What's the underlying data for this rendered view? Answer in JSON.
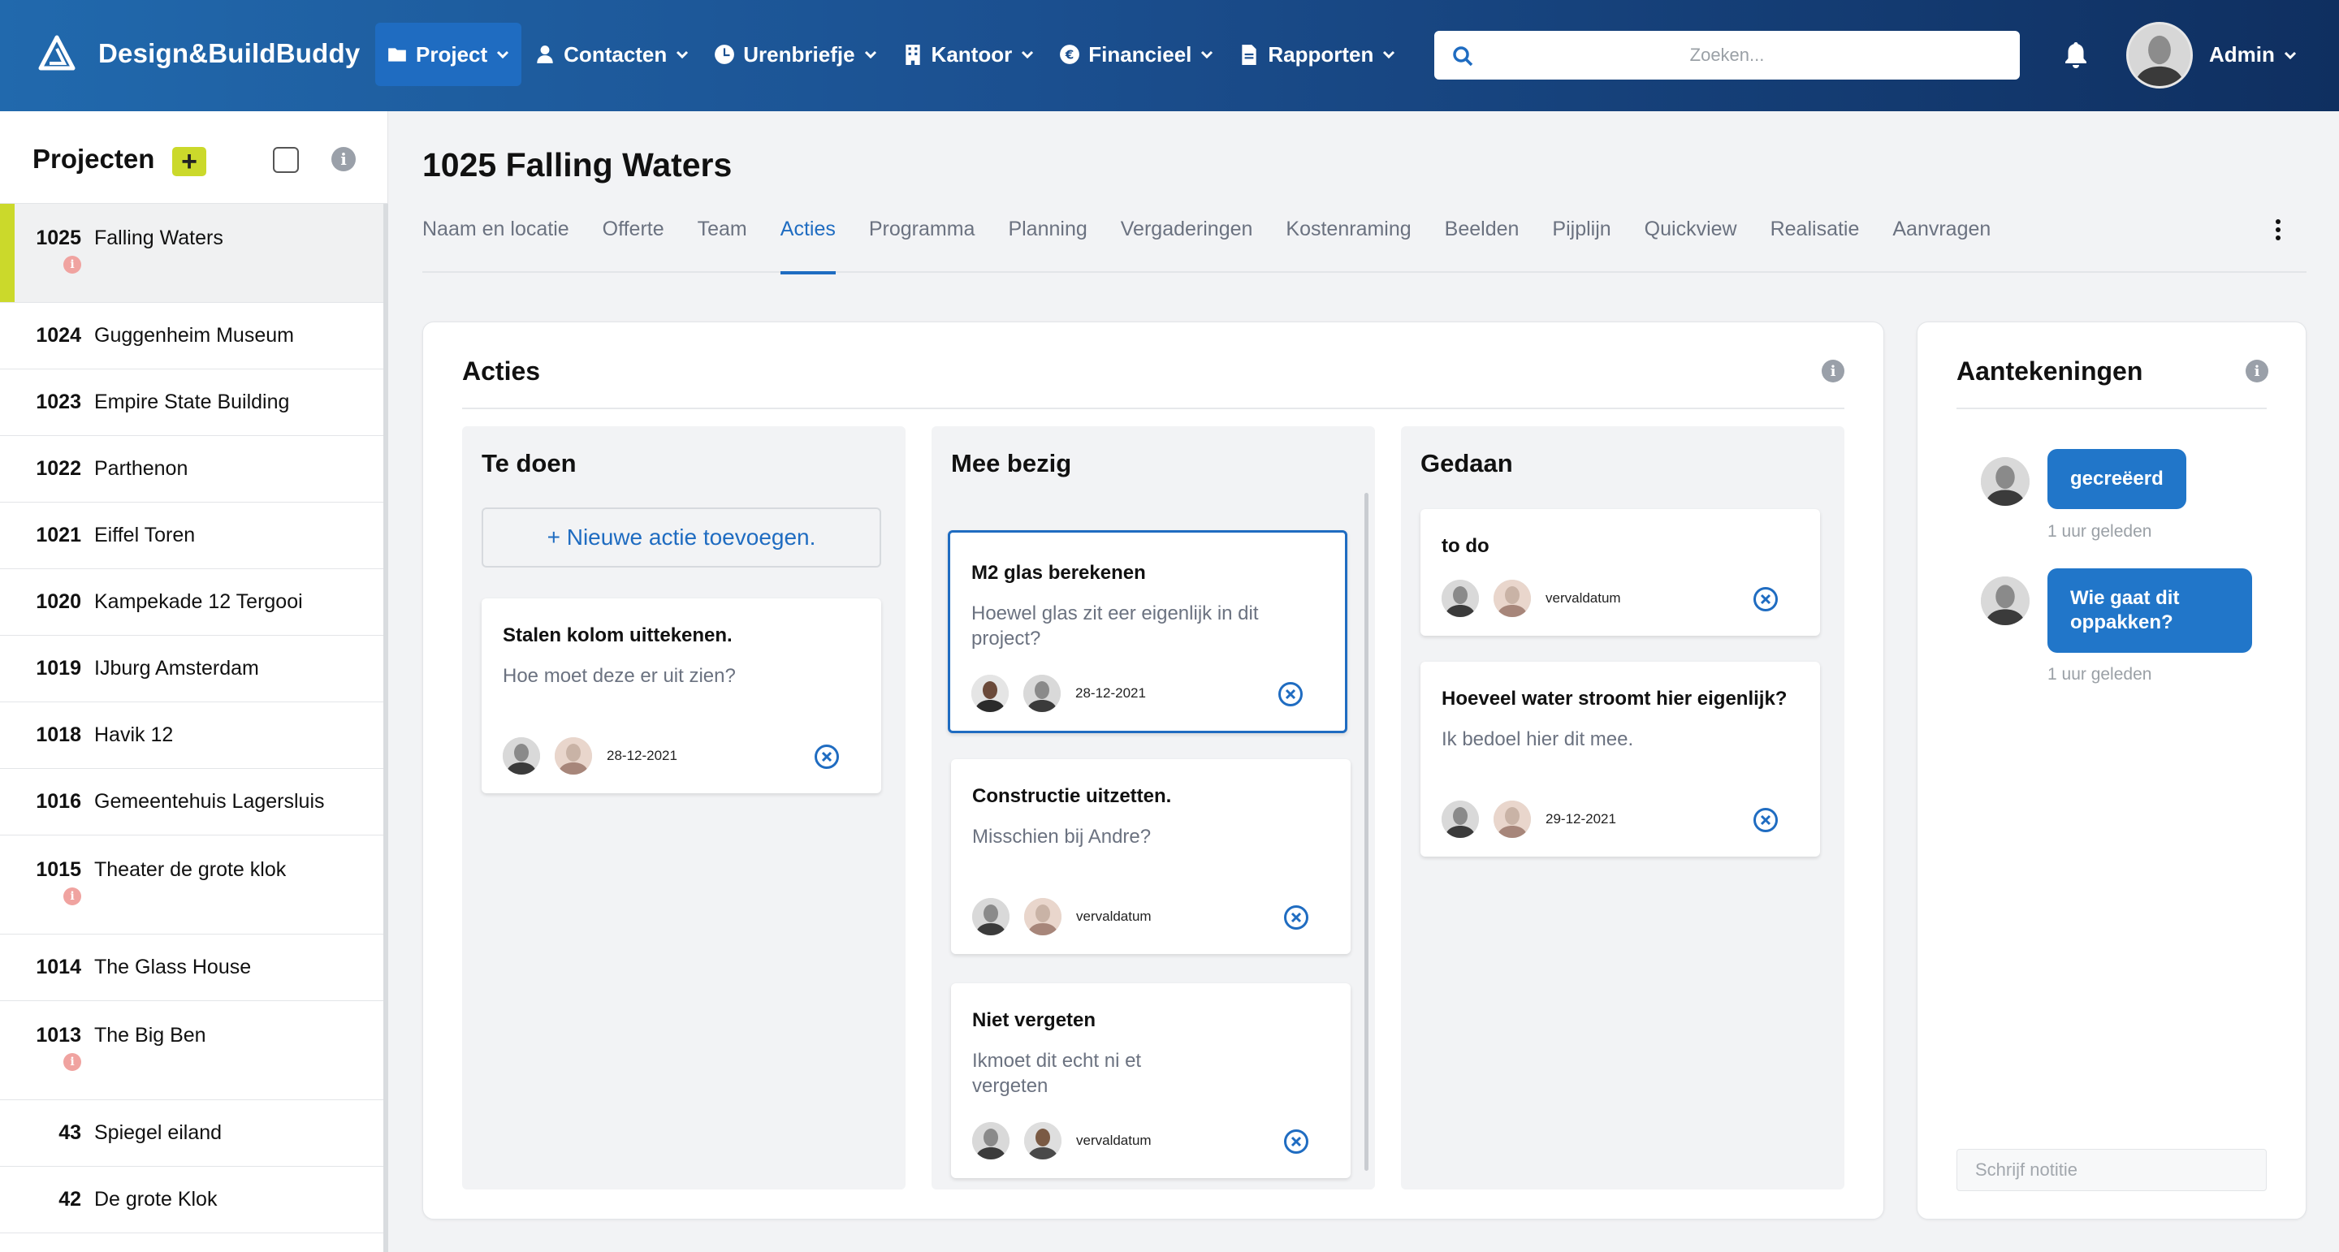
{
  "app": {
    "brand": "Design&BuildBuddy",
    "search_placeholder": "Zoeken...",
    "user_name": "Admin"
  },
  "nav": [
    {
      "label": "Project",
      "icon": "folder-icon",
      "active": true
    },
    {
      "label": "Contacten",
      "icon": "person-icon"
    },
    {
      "label": "Urenbriefje",
      "icon": "clock-icon"
    },
    {
      "label": "Kantoor",
      "icon": "building-icon"
    },
    {
      "label": "Financieel",
      "icon": "euro-icon"
    },
    {
      "label": "Rapporten",
      "icon": "document-icon"
    }
  ],
  "sidebar": {
    "title": "Projecten",
    "add_label": "+",
    "projects": [
      {
        "num": "1025",
        "name": "Falling Waters",
        "active": true,
        "alert": true
      },
      {
        "num": "1024",
        "name": "Guggenheim Museum"
      },
      {
        "num": "1023",
        "name": "Empire State Building"
      },
      {
        "num": "1022",
        "name": "Parthenon"
      },
      {
        "num": "1021",
        "name": "Eiffel Toren"
      },
      {
        "num": "1020",
        "name": "Kampekade 12 Tergooi"
      },
      {
        "num": "1019",
        "name": "IJburg Amsterdam"
      },
      {
        "num": "1018",
        "name": "Havik 12"
      },
      {
        "num": "1016",
        "name": "Gemeentehuis Lagersluis"
      },
      {
        "num": "1015",
        "name": "Theater de grote klok",
        "alert": true
      },
      {
        "num": "1014",
        "name": "The Glass House"
      },
      {
        "num": "1013",
        "name": "The Big Ben",
        "alert": true
      },
      {
        "num": "43",
        "name": "Spiegel eiland"
      },
      {
        "num": "42",
        "name": "De grote Klok"
      }
    ]
  },
  "main": {
    "title": "1025 Falling Waters",
    "tabs": [
      "Naam en locatie",
      "Offerte",
      "Team",
      "Acties",
      "Programma",
      "Planning",
      "Vergaderingen",
      "Kostenraming",
      "Beelden",
      "Pijplijn",
      "Quickview",
      "Realisatie",
      "Aanvragen"
    ],
    "active_tab": "Acties"
  },
  "acties": {
    "title": "Acties",
    "new_action": "+ Nieuwe actie toevoegen.",
    "columns": [
      {
        "title": "Te doen",
        "tasks": [
          {
            "title": "Stalen kolom uittekenen.",
            "desc": "Hoe moet deze er uit zien?",
            "date": "28-12-2021"
          }
        ]
      },
      {
        "title": "Mee bezig",
        "tasks": [
          {
            "title": "M2 glas berekenen",
            "desc": "Hoewel glas zit eer eigenlijk in dit project?",
            "date": "28-12-2021",
            "selected": true
          },
          {
            "title": "Constructie uitzetten.",
            "desc": "Misschien bij Andre?",
            "date": "vervaldatum"
          },
          {
            "title": "Niet vergeten",
            "desc": "Ikmoet dit echt ni et vergeten",
            "date": "vervaldatum"
          }
        ]
      },
      {
        "title": "Gedaan",
        "tasks": [
          {
            "title": "to do",
            "desc": "",
            "date": "vervaldatum"
          },
          {
            "title": "Hoeveel water stroomt hier eigenlijk?",
            "desc": "Ik bedoel hier dit mee.",
            "date": "29-12-2021"
          }
        ]
      }
    ]
  },
  "notes": {
    "title": "Aantekeningen",
    "items": [
      {
        "text": "gecreëerd",
        "time": "1 uur geleden"
      },
      {
        "text": "Wie gaat dit oppakken?",
        "time": "1 uur geleden"
      }
    ],
    "input_placeholder": "Schrijf notitie"
  },
  "colors": {
    "accent": "#1f6cc1",
    "brand_green": "#cbd92b",
    "alert": "#f0a3a0"
  }
}
